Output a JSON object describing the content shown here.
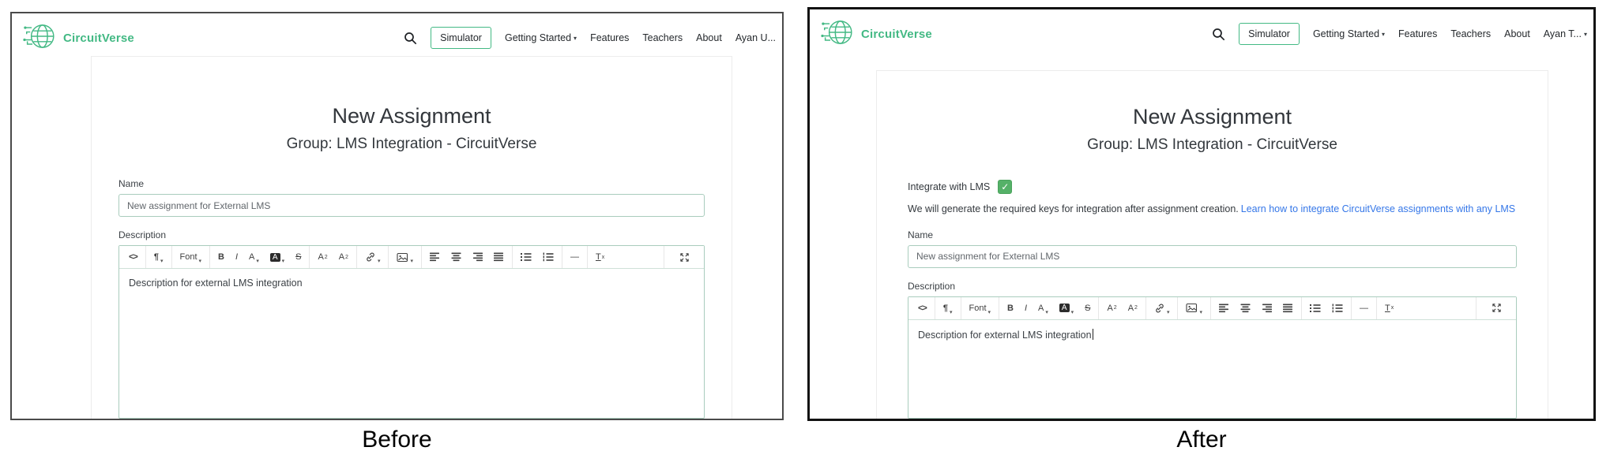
{
  "brand": {
    "name": "CircuitVerse"
  },
  "colors": {
    "brand_green": "#43b984",
    "field_border": "#a9ccbd",
    "link_blue": "#3577e8",
    "checkbox_green": "#55b168",
    "panel_border_before": "#4a4a4a",
    "panel_border_after": "#121212"
  },
  "icons": {
    "check": "✓",
    "caret_down": "▾",
    "search": "magnifier"
  },
  "nav": {
    "items": [
      {
        "label": "Simulator",
        "highlighted": true
      },
      {
        "label": "Getting Started",
        "dropdown": true
      },
      {
        "label": "Features"
      },
      {
        "label": "Teachers"
      },
      {
        "label": "About"
      }
    ]
  },
  "editor": {
    "toolbar": {
      "groups": [
        [
          {
            "name": "code-view",
            "label": "<>",
            "style": "code"
          }
        ],
        [
          {
            "name": "paragraph-format",
            "label": "¶",
            "style": "para",
            "dropdown": true
          }
        ],
        [
          {
            "name": "font-family",
            "label": "Font",
            "dropdown": true
          }
        ],
        [
          {
            "name": "bold",
            "label": "B",
            "style": "bold"
          },
          {
            "name": "italic",
            "label": "I",
            "style": "italic"
          },
          {
            "name": "text-color",
            "label": "A",
            "dropdown": true
          },
          {
            "name": "background-color",
            "label": "A",
            "style": "inverted",
            "dropdown": true
          },
          {
            "name": "strikethrough",
            "label": "S",
            "style": "strike"
          }
        ],
        [
          {
            "name": "superscript",
            "label": "A",
            "mark": "sup",
            "mark_text": "2"
          },
          {
            "name": "subscript",
            "label": "A",
            "mark": "sub",
            "mark_text": "2"
          }
        ],
        [
          {
            "name": "insert-link",
            "dropdown": true
          }
        ],
        [
          {
            "name": "insert-image",
            "dropdown": true
          }
        ],
        [
          {
            "name": "align-left"
          },
          {
            "name": "align-center"
          },
          {
            "name": "align-right"
          },
          {
            "name": "align-justify"
          }
        ],
        [
          {
            "name": "unordered-list"
          },
          {
            "name": "ordered-list"
          }
        ],
        [
          {
            "name": "horizontal-rule",
            "label": "—"
          }
        ],
        [
          {
            "name": "remove-format",
            "label": "T",
            "style": "removefmt",
            "mark": "sub",
            "mark_text": "x"
          }
        ]
      ],
      "fullscreen_name": "fullscreen"
    }
  },
  "panels": {
    "before": {
      "caption": "Before",
      "nav_user": "Ayan U...",
      "form": {
        "title": "New Assignment",
        "subtitle": "Group: LMS Integration - CircuitVerse",
        "name_label": "Name",
        "name_value": "New assignment for External LMS",
        "description_label": "Description",
        "description_value": "Description for external LMS integration"
      }
    },
    "after": {
      "caption": "After",
      "nav_user": "Ayan T...",
      "form": {
        "title": "New Assignment",
        "subtitle": "Group: LMS Integration - CircuitVerse",
        "integrate_label": "Integrate with LMS",
        "integrate_checked": true,
        "helper_text": "We will generate the required keys for integration after assignment creation.",
        "helper_link": "Learn how to integrate CircuitVerse assignments with any LMS",
        "name_label": "Name",
        "name_value": "New assignment for External LMS",
        "description_label": "Description",
        "description_value": "Description for external LMS integration"
      }
    }
  }
}
